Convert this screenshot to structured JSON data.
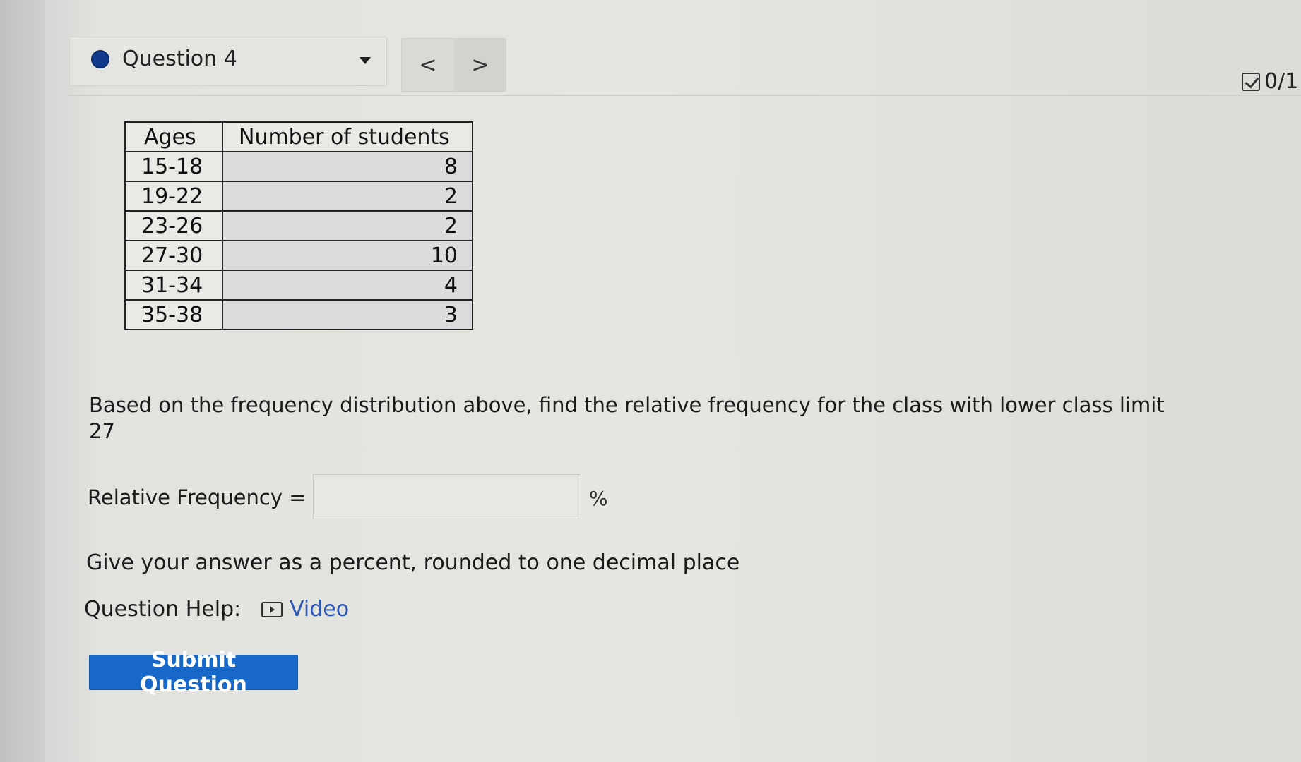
{
  "header": {
    "question_title": "Question 4",
    "prev_glyph": "<",
    "next_glyph": ">",
    "score": "0/1",
    "status_color": "#123a8c"
  },
  "table": {
    "headers": [
      "Ages",
      "Number of students"
    ],
    "rows": [
      {
        "age": "15-18",
        "count": "8"
      },
      {
        "age": "19-22",
        "count": "2"
      },
      {
        "age": "23-26",
        "count": "2"
      },
      {
        "age": "27-30",
        "count": "10"
      },
      {
        "age": "31-34",
        "count": "4"
      },
      {
        "age": "35-38",
        "count": "3"
      }
    ]
  },
  "question": {
    "prompt": "Based on the frequency distribution above, find the relative frequency for the class with lower class limit 27",
    "answer_label": "Relative Frequency =",
    "answer_value": "",
    "answer_unit": "%",
    "instruction": "Give your answer as a percent, rounded to one decimal place",
    "help_label": "Question Help:",
    "help_video_label": "Video",
    "submit_label": "Submit Question"
  },
  "icons": {
    "status": "filled-circle-icon",
    "dropdown": "caret-down-icon",
    "score": "checkbox-icon",
    "video": "video-play-icon"
  },
  "colors": {
    "submit_button": "#1768c8",
    "link": "#2b57b8"
  }
}
